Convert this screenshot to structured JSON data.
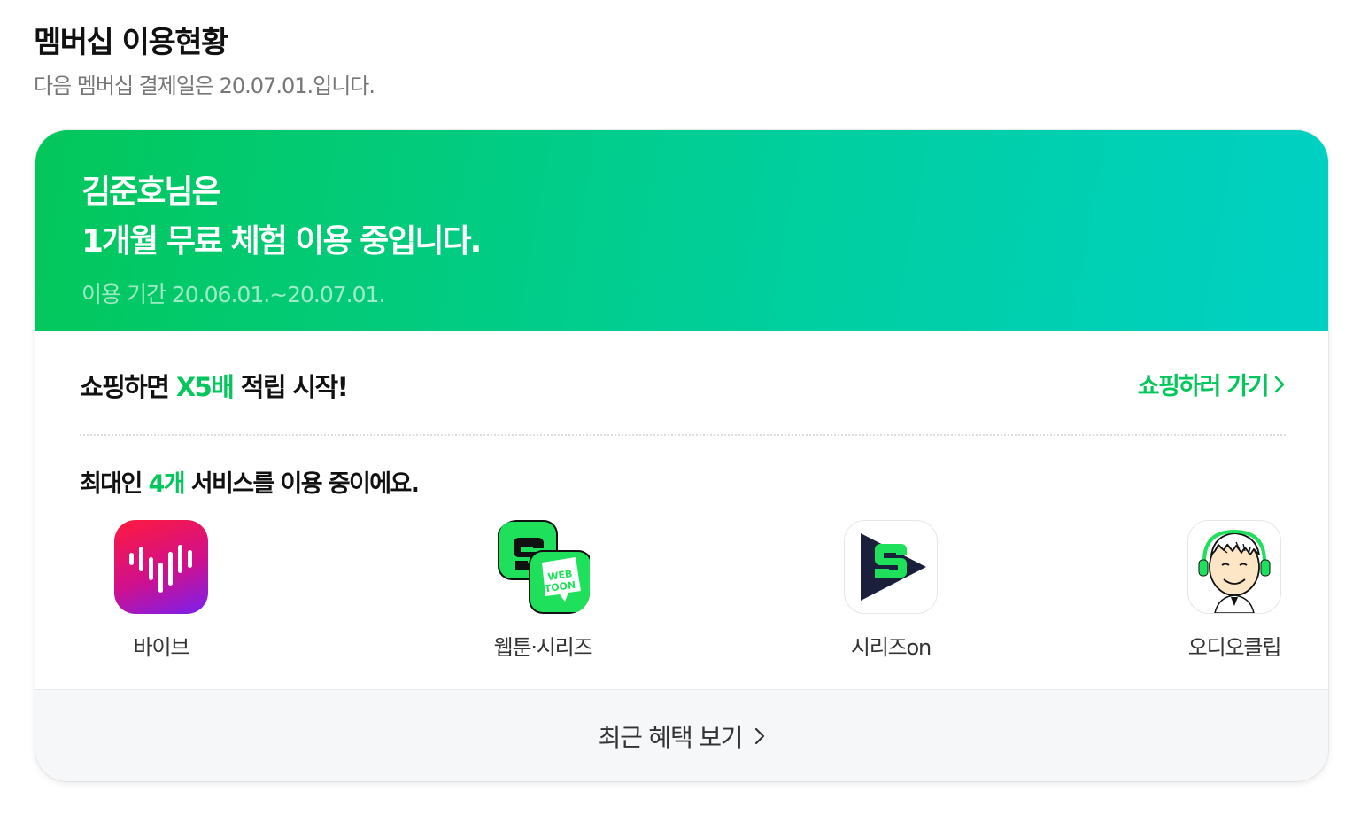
{
  "header": {
    "title": "멤버십 이용현황",
    "subtitle": "다음 멤버십 결제일은 20.07.01.입니다."
  },
  "banner": {
    "line1": "김준호님은",
    "line2": "1개월 무료 체험 이용 중입니다.",
    "period": "이용 기간 20.06.01.~20.07.01."
  },
  "promo": {
    "prefix": "쇼핑하면 ",
    "highlight": "X5배",
    "suffix": " 적립 시작!",
    "link_label": "쇼핑하러 가기"
  },
  "services": {
    "prefix": "최대인 ",
    "count": "4개",
    "suffix": " 서비스를 이용 중이에요.",
    "items": [
      {
        "label": "바이브",
        "icon": "vibe-icon"
      },
      {
        "label": "웹툰·시리즈",
        "icon": "webtoon-series-icon"
      },
      {
        "label": "시리즈on",
        "icon": "serieson-icon"
      },
      {
        "label": "오디오클립",
        "icon": "audioclip-icon"
      }
    ]
  },
  "footer": {
    "label": "최근 혜택 보기"
  },
  "colors": {
    "accent": "#03c75a",
    "banner_gradient_end": "#00d0c4"
  }
}
